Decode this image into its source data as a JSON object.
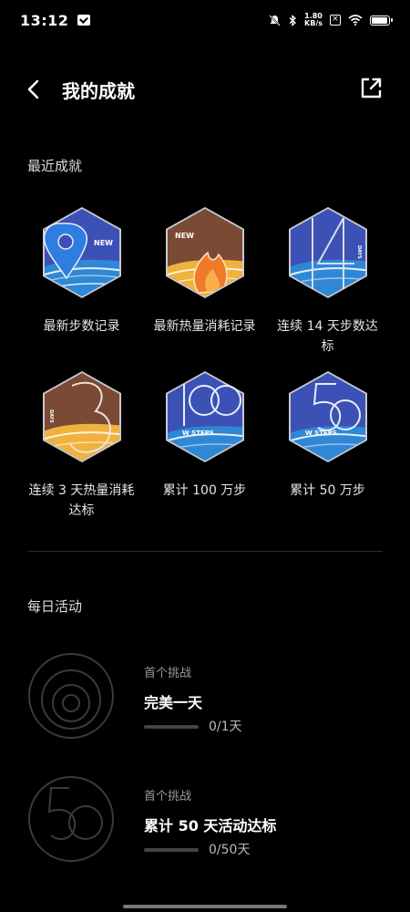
{
  "status": {
    "time": "13:12",
    "speed_top": "1.80",
    "speed_bottom": "KB/s"
  },
  "header": {
    "title": "我的成就"
  },
  "recent": {
    "title": "最近成就",
    "badges": [
      {
        "label": "最新步数记录",
        "tag": "NEW",
        "theme": "blue",
        "icon": "location-pin-icon"
      },
      {
        "label": "最新热量消耗记录",
        "tag": "NEW",
        "theme": "orange",
        "icon": "flame-icon"
      },
      {
        "label": "连续 14 天步数达标",
        "tag": "DAYS",
        "theme": "blue",
        "icon": "number-14-icon"
      },
      {
        "label": "连续 3 天热量消耗达标",
        "tag": "DAYS",
        "theme": "orange",
        "icon": "number-3-icon"
      },
      {
        "label": "累计 100 万步",
        "tag": "W STEPS",
        "theme": "blue",
        "icon": "number-100-icon"
      },
      {
        "label": "累计 50 万步",
        "tag": "W STEPS",
        "theme": "blue",
        "icon": "number-50-icon"
      }
    ]
  },
  "daily": {
    "title": "每日活动",
    "items": [
      {
        "sub": "首个挑战",
        "title": "完美一天",
        "progress_text": "0/1天",
        "progress": 0
      },
      {
        "sub": "首个挑战",
        "title": "累计 50 天活动达标",
        "progress_text": "0/50天",
        "progress": 0
      }
    ]
  },
  "colors": {
    "background": "#000000",
    "blue_badge": "#3a4fb0",
    "orange_badge": "#e8a13a",
    "brown_badge": "#7a4a34"
  }
}
